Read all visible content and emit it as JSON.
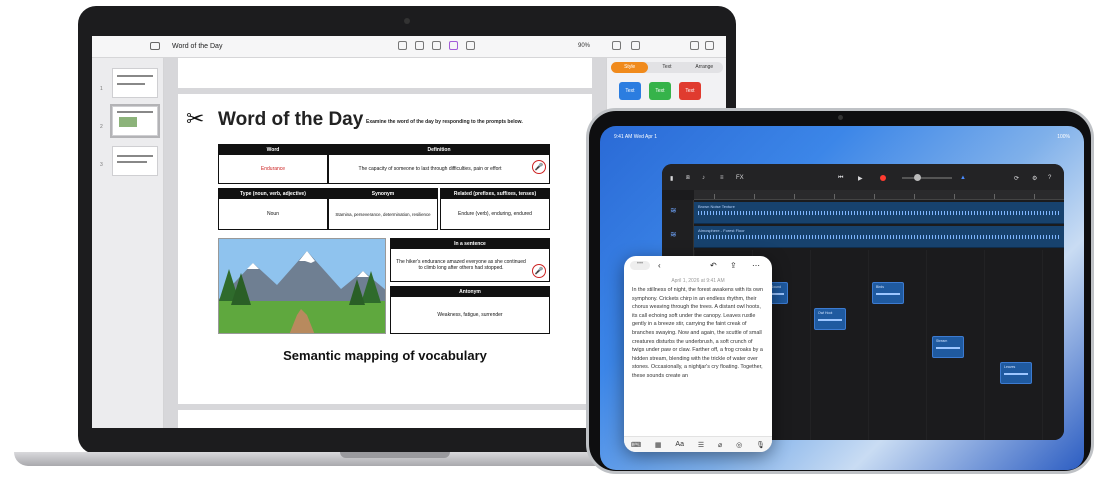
{
  "mac": {
    "doc_title": "Word of the Day",
    "zoom": "90%",
    "inspector": {
      "tabs": [
        "Style",
        "Text",
        "Arrange"
      ],
      "swatches": [
        {
          "label": "Text",
          "color": "#2b7de0"
        },
        {
          "label": "Text",
          "color": "#36b34a"
        },
        {
          "label": "Text",
          "color": "#e03b2f"
        }
      ]
    },
    "thumbs": [
      "1",
      "2",
      "3"
    ],
    "slide": {
      "title": "Word of the Day",
      "instruction": "Examine the word of the day by responding to the prompts below.",
      "word_header": "Word",
      "word_value": "Endurance",
      "definition_header": "Definition",
      "definition_value": "The capacity of someone to last through difficulties, pain or effort",
      "type_header": "Type (noun, verb, adjective)",
      "type_value": "Noun",
      "synonym_header": "Synonym",
      "synonym_value": "Stamina, perseverance, determination, resilience",
      "related_header": "Related (prefixes, suffixes, tenses)",
      "related_value": "Endure (verb), enduring, endured",
      "sentence_header": "In a sentence",
      "sentence_value": "The hiker's endurance amazed everyone as she continued to climb long after others had stopped.",
      "antonym_header": "Antonym",
      "antonym_value": "Weakness, fatigue, surrender",
      "caption": "Semantic mapping of vocabulary"
    },
    "colors": {
      "accent": "#f08a1c",
      "mic_ring": "#cc2222",
      "word_red": "#cc2222"
    }
  },
  "ipad": {
    "status_left": "9:41 AM   Wed Apr 1",
    "status_right": "100%",
    "garageband": {
      "toolbar_labels": [
        "FX"
      ],
      "lanes": [
        {
          "label": "Brown Noise Texture"
        },
        {
          "label": "Atmosphere - Forest Floor"
        }
      ],
      "regions": [
        {
          "label": "Forest Sound"
        },
        {
          "label": "Owl Hoot"
        },
        {
          "label": "Birds"
        },
        {
          "label": "Stream"
        },
        {
          "label": "Leaves"
        }
      ]
    },
    "notes": {
      "date": "April 1, 2026 at 9:41 AM",
      "body": "In the stillness of night, the forest awakens with its own symphony. Crickets chirp in an endless rhythm, their chorus weaving through the trees. A distant owl hoots, its call echoing soft under the canopy. Leaves rustle gently in a breeze stir, carrying the faint creak of branches swaying. Now and again, the scuttle of small creatures disturbs the underbrush, a soft crunch of twigs under paw or claw. Farther off, a frog croaks by a hidden stream, blending with the trickle of water over stones. Occasionally, a nightjar's cry floating. Together, these sounds create an"
    }
  }
}
